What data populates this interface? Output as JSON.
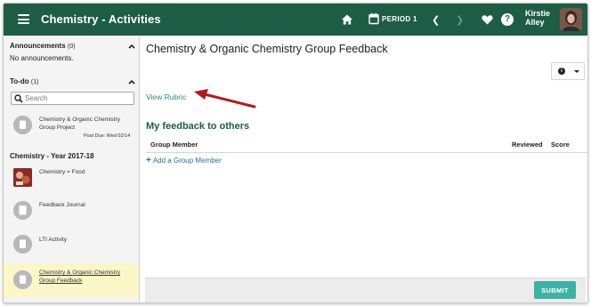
{
  "header": {
    "app_title": "Chemistry - Activities",
    "period_label": "PERIOD 1",
    "user_first": "Kirstie",
    "user_last": "Alley",
    "help_glyph": "?",
    "color": "#1e5d45"
  },
  "sidebar": {
    "announcements_title": "Announcements",
    "announcements_count": "(0)",
    "no_announcements": "No announcements.",
    "todo_title": "To-do",
    "todo_count": "(1)",
    "search_placeholder": "Search",
    "todo_items": [
      {
        "label": "Chemistry & Organic Chemistry Group Project",
        "due": "Post Due: Wed 02/14",
        "icon": "assignment-circle-icon"
      }
    ],
    "course_title": "Chemistry - Year 2017-18",
    "course_items": [
      {
        "label": "Chemistry = Food",
        "icon": "food-thumbnail",
        "active": false
      },
      {
        "label": "Feedback Journal",
        "icon": "journal-circle-icon",
        "active": false
      },
      {
        "label": "LTI Activity",
        "icon": "lti-circle-icon",
        "active": false
      },
      {
        "label": "Chemistry & Organic Chemistry Group Feedback",
        "icon": "feedback-circle-icon",
        "active": true
      }
    ]
  },
  "main": {
    "page_title": "Chemistry & Organic Chemistry Group Feedback",
    "info_glyph": "i",
    "rubric_link": "View Rubric",
    "section_title": "My feedback to others",
    "table_headers": [
      "Group Member",
      "Reviewed",
      "Score"
    ],
    "add_member": "Add a Group Member",
    "add_glyph": "+",
    "submit_label": "SUBMIT",
    "accent": "#3eb3a3",
    "annotation_arrow_color": "#b3191c"
  }
}
